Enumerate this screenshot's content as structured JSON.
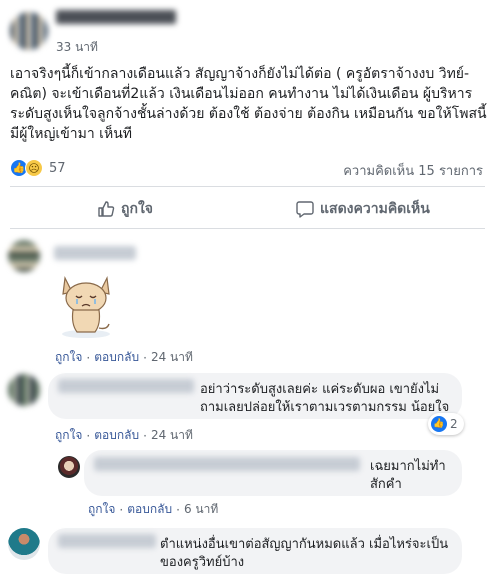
{
  "post": {
    "time": "33 นาที",
    "body": "เอาจริงๆนี้ก็เข้ากลางเดือนแล้ว สัญญาจ้างก็ยังไม่ได้ต่อ ( ครูอัตราจ้างงบ วิทย์-คณิต) จะเข้าเดือนที่2แล้ว เงินเดือนไม่ออก คนทำงาน ไม่ได้เงินเดือน ผู้บริหารระดับสูงเห็นใจลูกจ้างชั้นล่างด้วย ต้องใช้ ต้องจ่าย ต้องกิน เหมือนกัน ขอให้โพสนี้ มีผู้ใหญ่เข้ามา เห็นที",
    "reaction_count": "57",
    "comment_count": "ความคิดเห็น 15 รายการ"
  },
  "actions": {
    "like": "ถูกใจ",
    "comment": "แสดงความคิดเห็น"
  },
  "comments": [
    {
      "like": "ถูกใจ",
      "reply": "ตอบกลับ",
      "time": "24 นาที"
    },
    {
      "text": "อย่าว่าระดับสูงเลยค่ะ แค่ระดับผอ เขายังไม่ถามเลยปล่อยให้เราตามเวรตามกรรม น้อยใจ",
      "like": "ถูกใจ",
      "reply": "ตอบกลับ",
      "time": "24 นาที",
      "reaction_count": "2"
    },
    {
      "text": "เฉยมากไม่ทำสักคำ",
      "like": "ถูกใจ",
      "reply": "ตอบกลับ",
      "time": "6 นาที"
    },
    {
      "text": "ตำแหน่งอื่นเขาต่อสัญญากันหมดแล้ว เมื่อไหร่จะเป็นของครูวิทย์บ้าง"
    }
  ],
  "icons": {
    "like": "thumbs-up-icon",
    "comment": "speech-bubble-icon",
    "sad": "sad-face-icon",
    "sticker": "crying-cat-sticker"
  },
  "colors": {
    "link": "#385898",
    "meta": "#606770",
    "bubble": "#f2f3f5",
    "brand": "#1877f2"
  }
}
